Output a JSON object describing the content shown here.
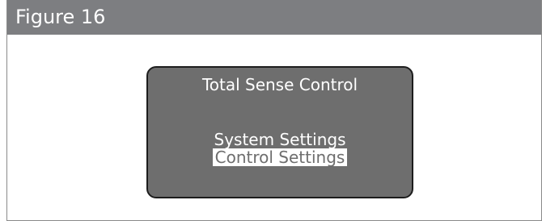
{
  "figure": {
    "title": "Figure 16"
  },
  "screen": {
    "title": "Total Sense Control",
    "menu_items": [
      {
        "label": "System Settings",
        "selected": false
      },
      {
        "label": "Control Settings",
        "selected": true
      }
    ]
  },
  "colors": {
    "header_bg": "#7d7e81",
    "screen_bg": "#6e6e6e",
    "screen_border": "#1d1d1d",
    "text_light": "#ffffff"
  }
}
